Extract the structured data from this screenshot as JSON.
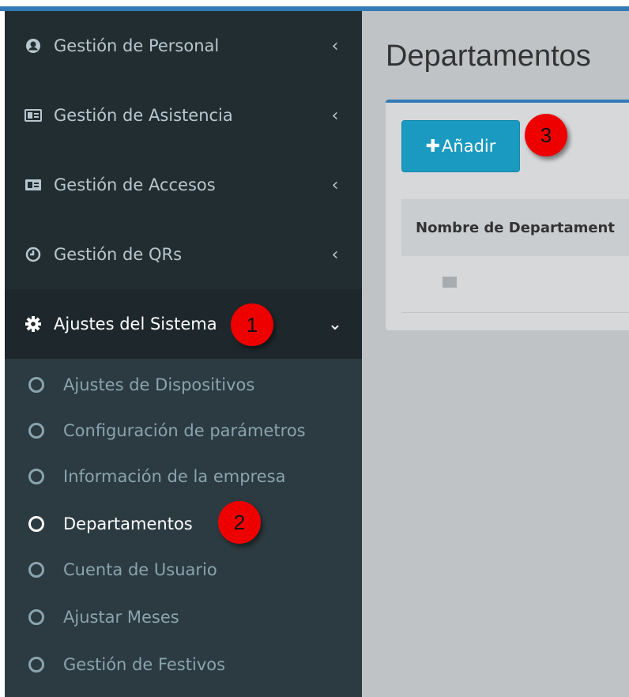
{
  "sidebar": {
    "items": [
      {
        "label": "Gestión de Personal",
        "icon": "user-circle-icon"
      },
      {
        "label": "Gestión de Asistencia",
        "icon": "id-card-icon"
      },
      {
        "label": "Gestión de Accesos",
        "icon": "id-card-icon"
      },
      {
        "label": "Gestión de QRs",
        "icon": "clock-icon"
      },
      {
        "label": "Ajustes del Sistema",
        "icon": "gear-icon"
      }
    ],
    "submenu": [
      {
        "label": "Ajustes de Dispositivos"
      },
      {
        "label": "Configuración de parámetros"
      },
      {
        "label": "Información de la empresa"
      },
      {
        "label": "Departamentos"
      },
      {
        "label": "Cuenta de Usuario"
      },
      {
        "label": "Ajustar Meses"
      },
      {
        "label": "Gestión de Festivos"
      }
    ]
  },
  "main": {
    "title": "Departamentos",
    "add_button": "Añadir",
    "table": {
      "headers": [
        "Nombre de Departament"
      ]
    }
  },
  "annotations": [
    "1",
    "2",
    "3"
  ],
  "colors": {
    "sidebar_bg": "#222d32",
    "submenu_bg": "#2c3b41",
    "accent": "#337ab7",
    "button": "#1a9ac0",
    "badge": "#ee0000"
  }
}
